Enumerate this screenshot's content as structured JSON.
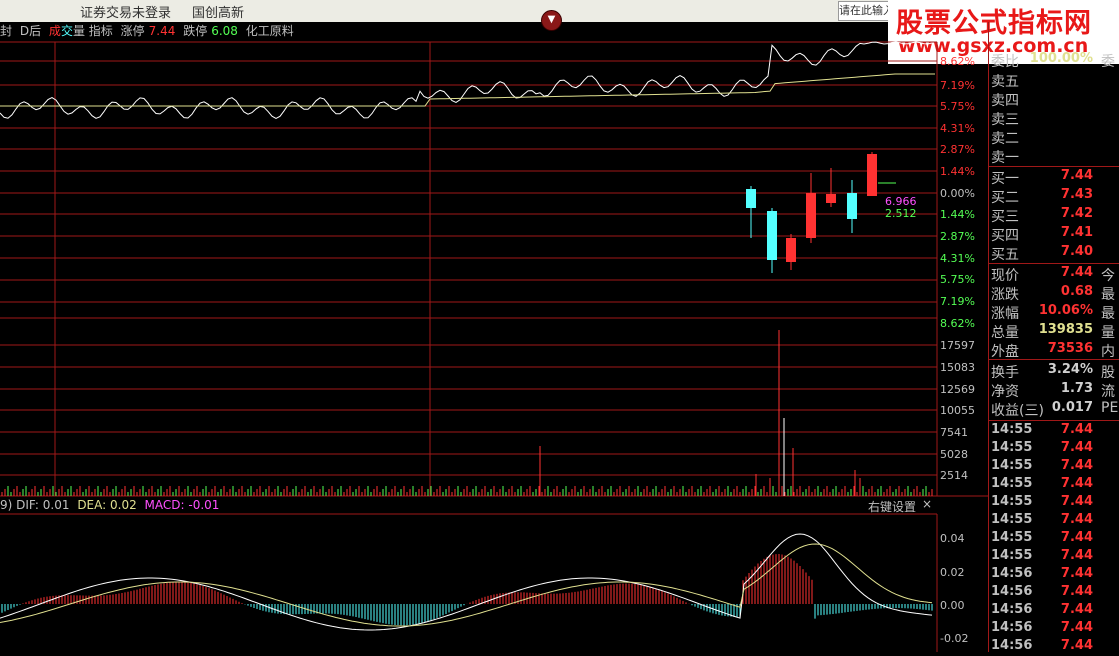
{
  "topbar": {
    "items": [
      "证券交易未登录",
      "国创高新"
    ],
    "search_placeholder": "请在此输入"
  },
  "watermark": {
    "title": "股票公式指标网",
    "url": "www.gsxz.com.cn"
  },
  "infobar": {
    "left_trunc": "封",
    "mode": "D后",
    "tabs": [
      "成交量",
      "指标"
    ],
    "zhangting_label": "涨停",
    "zhangting_value": "7.44",
    "dieting_label": "跌停",
    "dieting_value": "6.08",
    "sector": "化工原料"
  },
  "pct_axis": {
    "upper": [
      "8.62%",
      "7.19%",
      "5.75%",
      "4.31%",
      "2.87%",
      "1.44%",
      "0.00%"
    ],
    "lower": [
      "1.44%",
      "2.87%",
      "4.31%",
      "5.75%",
      "7.19%",
      "8.62%"
    ]
  },
  "vol_axis": [
    "17597",
    "15083",
    "12569",
    "10055",
    "7541",
    "5028",
    "2514"
  ],
  "macd_axis": [
    "0.04",
    "0.02",
    "0.00",
    "-0.02"
  ],
  "candle_labels": {
    "high": "6.966",
    "low": "2.512"
  },
  "macd": {
    "prefix": "9)",
    "dif": "DIF: 0.01",
    "dea": "DEA: 0.02",
    "macd": "MACD: -0.01",
    "right_click": "右键设置",
    "close": "×"
  },
  "quote_panel": {
    "top_trunc": "委比",
    "top_trunc_val": "100.00%",
    "top_trunc_end": "委",
    "sell": [
      "卖五",
      "卖四",
      "卖三",
      "卖二",
      "卖一"
    ],
    "buy": [
      {
        "label": "买一",
        "price": "7.44"
      },
      {
        "label": "买二",
        "price": "7.43"
      },
      {
        "label": "买三",
        "price": "7.42"
      },
      {
        "label": "买四",
        "price": "7.41"
      },
      {
        "label": "买五",
        "price": "7.40"
      }
    ],
    "stats": [
      {
        "label": "现价",
        "value": "7.44",
        "end": "今",
        "color": "#ff3232"
      },
      {
        "label": "涨跌",
        "value": "0.68",
        "end": "最",
        "color": "#ff3232"
      },
      {
        "label": "涨幅",
        "value": "10.06%",
        "end": "最",
        "color": "#ff3232"
      },
      {
        "label": "总量",
        "value": "139835",
        "end": "量",
        "color": "#e0e090"
      },
      {
        "label": "外盘",
        "value": "73536",
        "end": "内",
        "color": "#ff3232"
      },
      {
        "label": "换手",
        "value": "3.24%",
        "end": "股",
        "color": "#d0d0d0"
      },
      {
        "label": "净资",
        "value": "1.73",
        "end": "流",
        "color": "#d0d0d0"
      },
      {
        "label": "收益(三)",
        "value": "0.017",
        "end": "PE",
        "color": "#d0d0d0"
      }
    ],
    "ticks": [
      {
        "time": "14:55",
        "price": "7.44"
      },
      {
        "time": "14:55",
        "price": "7.44"
      },
      {
        "time": "14:55",
        "price": "7.44"
      },
      {
        "time": "14:55",
        "price": "7.44"
      },
      {
        "time": "14:55",
        "price": "7.44"
      },
      {
        "time": "14:55",
        "price": "7.44"
      },
      {
        "time": "14:55",
        "price": "7.44"
      },
      {
        "time": "14:55",
        "price": "7.44"
      },
      {
        "time": "14:56",
        "price": "7.44"
      },
      {
        "time": "14:56",
        "price": "7.44"
      },
      {
        "time": "14:56",
        "price": "7.44"
      },
      {
        "time": "14:56",
        "price": "7.44"
      },
      {
        "time": "14:56",
        "price": "7.44"
      }
    ]
  },
  "colors": {
    "grid": "#a01818",
    "up": "#ff3232",
    "down": "#54ffff",
    "price_line": "#ffffff",
    "avg_line": "#e0e090",
    "dea": "#e0e090",
    "macd_label": "#ff50ff"
  }
}
